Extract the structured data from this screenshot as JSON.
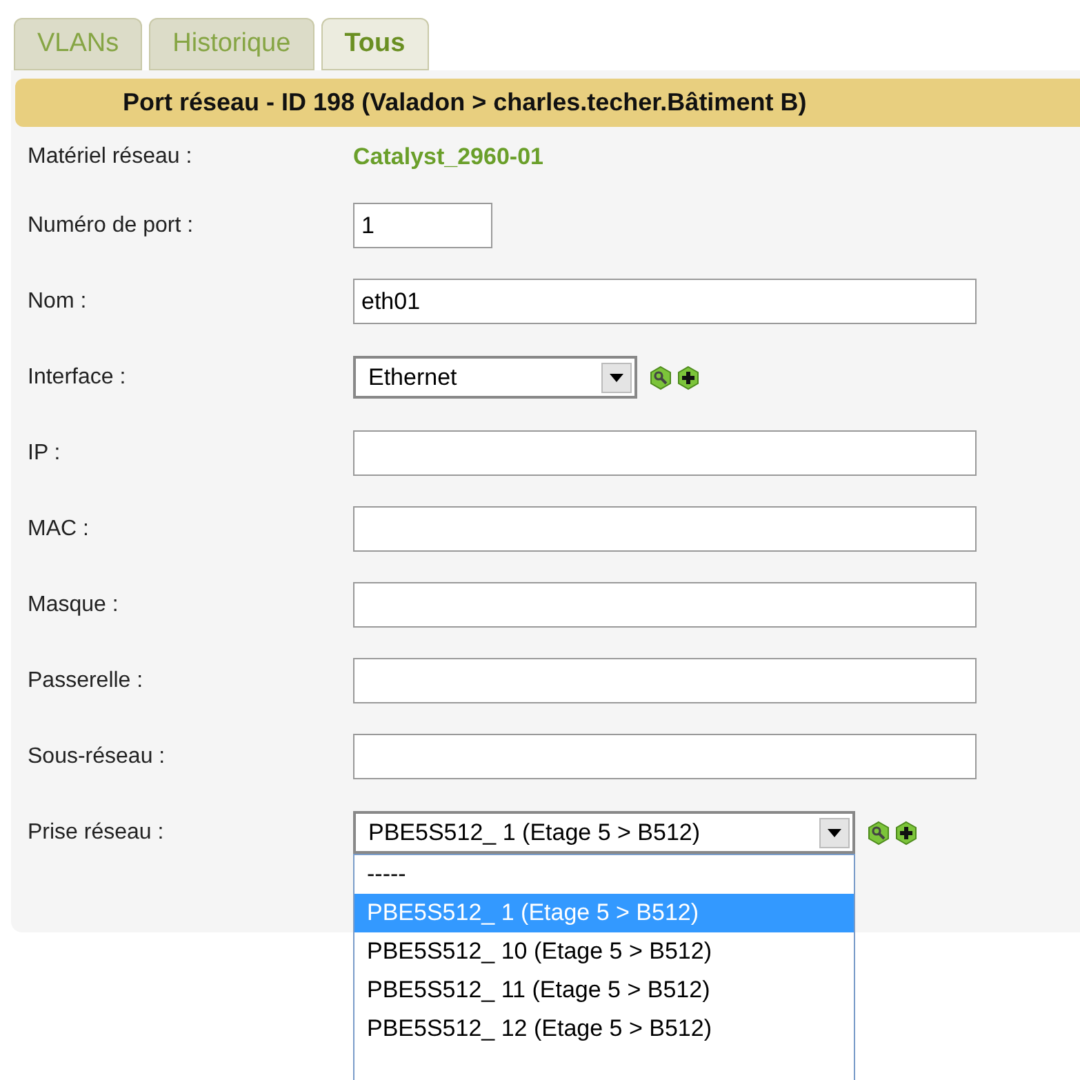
{
  "tabs": [
    {
      "label": "VLANs",
      "selected": false
    },
    {
      "label": "Historique",
      "selected": false
    },
    {
      "label": "Tous",
      "selected": true
    }
  ],
  "panel": {
    "title": "Port réseau - ID 198 (Valadon > charles.techer.Bâtiment B)",
    "rows": [
      {
        "kind": "link",
        "label": "Matériel réseau :",
        "value": "Catalyst_2960-01"
      },
      {
        "kind": "short",
        "label": "Numéro de port :",
        "value": "1"
      },
      {
        "kind": "text",
        "label": "Nom :",
        "value": "eth01"
      },
      {
        "kind": "select",
        "label": "Interface :",
        "value": "Ethernet"
      },
      {
        "kind": "text",
        "label": "IP :"
      },
      {
        "kind": "text",
        "label": "MAC :"
      },
      {
        "kind": "text",
        "label": "Masque :"
      },
      {
        "kind": "text",
        "label": "Passerelle :"
      },
      {
        "kind": "text",
        "label": "Sous-réseau :"
      },
      {
        "kind": "wideselect",
        "label": "Prise réseau :",
        "value": "PBE5S512_ 1 (Etage 5 > B512)",
        "expanded": true,
        "options": [
          {
            "label": "-----",
            "selected": false
          },
          {
            "label": "PBE5S512_ 1 (Etage 5 > B512)",
            "selected": true
          },
          {
            "label": "PBE5S512_ 10 (Etage 5 > B512)",
            "selected": false
          },
          {
            "label": "PBE5S512_ 11 (Etage 5 > B512)",
            "selected": false
          },
          {
            "label": "PBE5S512_ 12 (Etage 5 > B512)",
            "selected": false
          }
        ]
      }
    ]
  }
}
